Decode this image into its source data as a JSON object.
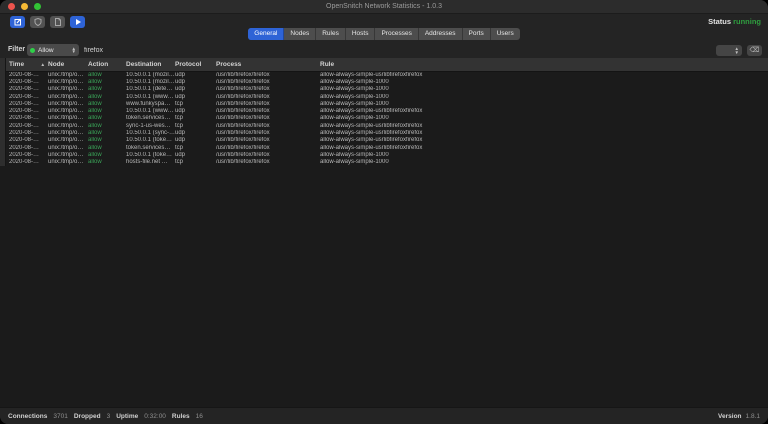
{
  "window": {
    "title": "OpenSnitch Network Statistics - 1.0.3"
  },
  "toolbar": {
    "buttons": [
      {
        "name": "new-rule-button",
        "icon": "edit-square-icon"
      },
      {
        "name": "security-button",
        "icon": "shield-icon"
      },
      {
        "name": "export-button",
        "icon": "document-icon"
      },
      {
        "name": "start-button",
        "icon": "play-icon"
      }
    ],
    "status_label": "Status",
    "status_value": "running"
  },
  "tabs": {
    "items": [
      "General",
      "Nodes",
      "Rules",
      "Hosts",
      "Processes",
      "Addresses",
      "Ports",
      "Users"
    ],
    "active_index": 0
  },
  "filter": {
    "label": "Filter",
    "action_selected": "Allow",
    "query": "firefox",
    "limit_value": "",
    "clear_icon": "backspace-icon",
    "clear_glyph": "⌫"
  },
  "table": {
    "columns": [
      "Time",
      "Node",
      "Action",
      "Destination",
      "Protocol",
      "Process",
      "Rule"
    ],
    "column_keys": [
      "time",
      "node",
      "action",
      "destination",
      "protocol",
      "process",
      "rule"
    ],
    "sort_column": "Time",
    "sort_indicator": "▴",
    "rows": [
      {
        "time": "2020-08-…",
        "node": "unix:/tmp/o…",
        "action": "allow",
        "destination": "10.50.0.1 (mozil…",
        "protocol": "udp",
        "process": "/usr/lib/firefox/firefox",
        "rule": "allow-always-simple-usrlibfirefoxfirefox"
      },
      {
        "time": "2020-08-…",
        "node": "unix:/tmp/o…",
        "action": "allow",
        "destination": "10.50.0.1 (mozil…",
        "protocol": "udp",
        "process": "/usr/lib/firefox/firefox",
        "rule": "allow-always-simple-1000"
      },
      {
        "time": "2020-08-…",
        "node": "unix:/tmp/o…",
        "action": "allow",
        "destination": "10.50.0.1 (dete…",
        "protocol": "udp",
        "process": "/usr/lib/firefox/firefox",
        "rule": "allow-always-simple-1000"
      },
      {
        "time": "2020-08-…",
        "node": "unix:/tmp/o…",
        "action": "allow",
        "destination": "10.50.0.1 (www…",
        "protocol": "udp",
        "process": "/usr/lib/firefox/firefox",
        "rule": "allow-always-simple-1000"
      },
      {
        "time": "2020-08-…",
        "node": "unix:/tmp/o…",
        "action": "allow",
        "destination": "www.funkyspa…",
        "protocol": "tcp",
        "process": "/usr/lib/firefox/firefox",
        "rule": "allow-always-simple-1000"
      },
      {
        "time": "2020-08-…",
        "node": "unix:/tmp/o…",
        "action": "allow",
        "destination": "10.50.0.1 (www…",
        "protocol": "udp",
        "process": "/usr/lib/firefox/firefox",
        "rule": "allow-always-simple-usrlibfirefoxfirefox"
      },
      {
        "time": "2020-08-…",
        "node": "unix:/tmp/o…",
        "action": "allow",
        "destination": "token.services…",
        "protocol": "tcp",
        "process": "/usr/lib/firefox/firefox",
        "rule": "allow-always-simple-1000"
      },
      {
        "time": "2020-08-…",
        "node": "unix:/tmp/o…",
        "action": "allow",
        "destination": "sync-1-us-wes…",
        "protocol": "tcp",
        "process": "/usr/lib/firefox/firefox",
        "rule": "allow-always-simple-usrlibfirefoxfirefox"
      },
      {
        "time": "2020-08-…",
        "node": "unix:/tmp/o…",
        "action": "allow",
        "destination": "10.50.0.1 (sync-…",
        "protocol": "udp",
        "process": "/usr/lib/firefox/firefox",
        "rule": "allow-always-simple-usrlibfirefoxfirefox"
      },
      {
        "time": "2020-08-…",
        "node": "unix:/tmp/o…",
        "action": "allow",
        "destination": "10.50.0.1 (toke…",
        "protocol": "udp",
        "process": "/usr/lib/firefox/firefox",
        "rule": "allow-always-simple-usrlibfirefoxfirefox"
      },
      {
        "time": "2020-08-…",
        "node": "unix:/tmp/o…",
        "action": "allow",
        "destination": "token.services…",
        "protocol": "tcp",
        "process": "/usr/lib/firefox/firefox",
        "rule": "allow-always-simple-usrlibfirefoxfirefox"
      },
      {
        "time": "2020-08-…",
        "node": "unix:/tmp/o…",
        "action": "allow",
        "destination": "10.50.0.1 (toke…",
        "protocol": "udp",
        "process": "/usr/lib/firefox/firefox",
        "rule": "allow-always-simple-1000"
      },
      {
        "time": "2020-08-…",
        "node": "unix:/tmp/o…",
        "action": "allow",
        "destination": "hosts-file.net …",
        "protocol": "tcp",
        "process": "/usr/lib/firefox/firefox",
        "rule": "allow-always-simple-1000"
      }
    ]
  },
  "statusbar": {
    "connections_label": "Connections",
    "connections_value": "3701",
    "dropped_label": "Dropped",
    "dropped_value": "3",
    "uptime_label": "Uptime",
    "uptime_value": "0:32:00",
    "rules_label": "Rules",
    "rules_value": "16",
    "version_label": "Version",
    "version_value": "1.8.1"
  },
  "colors": {
    "accent_blue": "#2e63d6",
    "status_running_green": "#2f9e3f",
    "allow_green": "#3aa257",
    "traffic_red": "#ee544d",
    "traffic_yellow": "#f5b935",
    "traffic_green": "#32c235"
  }
}
